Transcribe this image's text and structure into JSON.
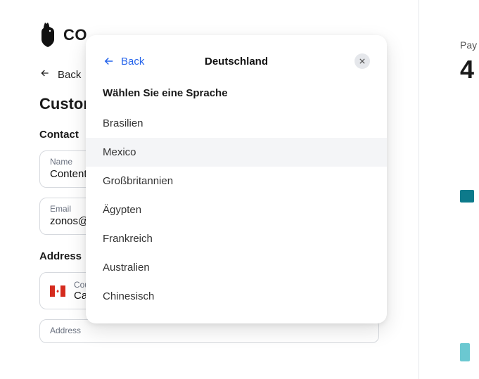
{
  "brand": {
    "name": "CO"
  },
  "back_label": "Back",
  "page_title": "Custom",
  "sections": {
    "contact": {
      "title": "Contact"
    },
    "address": {
      "title": "Address"
    }
  },
  "fields": {
    "name": {
      "label": "Name",
      "value": "Content"
    },
    "email": {
      "label": "Email",
      "value": "zonos@"
    },
    "country": {
      "label": "Country",
      "value": "Canada"
    },
    "addr": {
      "label": "Address"
    }
  },
  "summary": {
    "pay_label": "Pay",
    "amount_prefix": "4"
  },
  "modal": {
    "back_label": "Back",
    "title": "Deutschland",
    "section_title": "Wählen Sie eine Sprache",
    "options": [
      {
        "label": "Brasilien",
        "hover": false
      },
      {
        "label": "Mexico",
        "hover": true
      },
      {
        "label": "Großbritannien",
        "hover": false
      },
      {
        "label": "Ägypten",
        "hover": false
      },
      {
        "label": "Frankreich",
        "hover": false
      },
      {
        "label": "Australien",
        "hover": false
      },
      {
        "label": "Chinesisch",
        "hover": false
      }
    ]
  }
}
